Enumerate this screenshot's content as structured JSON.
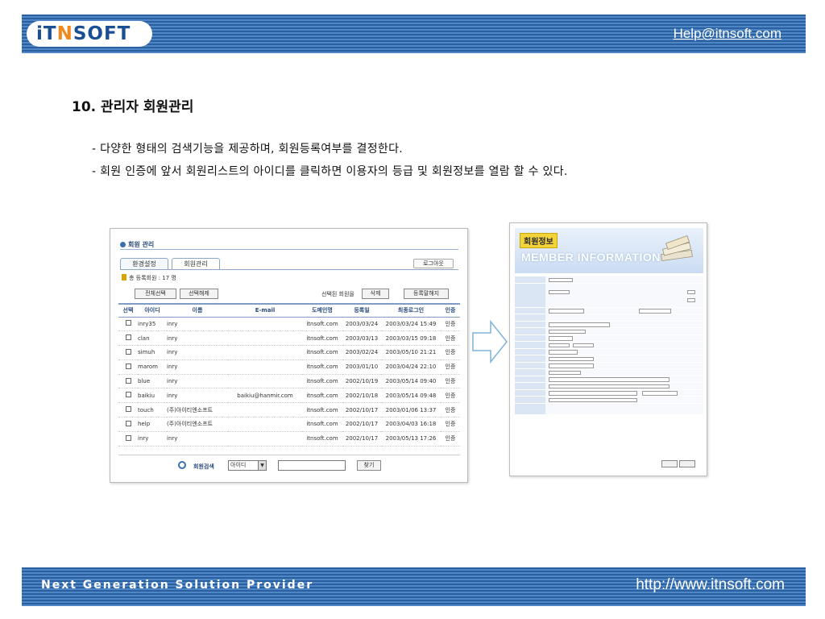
{
  "header": {
    "logo_it": "iT",
    "logo_n": "N",
    "logo_soft": "SOFT",
    "help": "Help@itnsoft.com"
  },
  "content": {
    "title": "10. 관리자 회원관리",
    "bullets": [
      "- 다양한 형태의 검색기능을 제공하며, 회원등록여부를 결정한다.",
      "- 회원 인증에 앞서 회원리스트의 아이디를 클릭하면 이용자의 등급  및 회원정보를 열람 할 수 있다."
    ]
  },
  "member_management": {
    "title": "회원 관리",
    "tabs": [
      "환경설정",
      "회원관리"
    ],
    "logout": "로그아웃",
    "total": "총 등록회원 : 17 명",
    "select_all": "전체선택",
    "deselect": "선택해제",
    "selected_label": "선택된 회원을",
    "delete": "삭제",
    "unregister": "등록말해지",
    "columns": [
      "선택",
      "아이디",
      "이름",
      "E-mail",
      "도메인명",
      "등록일",
      "최종로그인",
      "인증"
    ],
    "rows": [
      {
        "id": "inry35",
        "name": "inry",
        "email": "",
        "domain": "itnsoft.com",
        "registered": "2003/03/24",
        "last_login": "2003/03/24 15:49",
        "auth": "인증"
      },
      {
        "id": "clan",
        "name": "inry",
        "email": "",
        "domain": "itnsoft.com",
        "registered": "2003/03/13",
        "last_login": "2003/03/15 09:18",
        "auth": "인증"
      },
      {
        "id": "simuh",
        "name": "inry",
        "email": "",
        "domain": "itnsoft.com",
        "registered": "2003/02/24",
        "last_login": "2003/05/10 21:21",
        "auth": "인증"
      },
      {
        "id": "marom",
        "name": "inry",
        "email": "",
        "domain": "itnsoft.com",
        "registered": "2003/01/10",
        "last_login": "2003/04/24 22:10",
        "auth": "인증"
      },
      {
        "id": "blue",
        "name": "inry",
        "email": "",
        "domain": "itnsoft.com",
        "registered": "2002/10/19",
        "last_login": "2003/05/14 09:40",
        "auth": "인증"
      },
      {
        "id": "baikiu",
        "name": "inry",
        "email": "baikiu@hanmir.com",
        "domain": "itnsoft.com",
        "registered": "2002/10/18",
        "last_login": "2003/05/14 09:48",
        "auth": "인증"
      },
      {
        "id": "touch",
        "name": "(주)아이티엔소프트",
        "email": "",
        "domain": "itnsoft.com",
        "registered": "2002/10/17",
        "last_login": "2003/01/06 13:37",
        "auth": "인증"
      },
      {
        "id": "help",
        "name": "(주)아이티엔소프트",
        "email": "",
        "domain": "itnsoft.com",
        "registered": "2002/10/17",
        "last_login": "2003/04/03 16:18",
        "auth": "인증"
      },
      {
        "id": "inry",
        "name": "inry",
        "email": "",
        "domain": "itnsoft.com",
        "registered": "2002/10/17",
        "last_login": "2003/05/13 17:26",
        "auth": "인증"
      }
    ],
    "search_label": "회원검색",
    "search_option": "아이디",
    "search_button": "찾기"
  },
  "member_info": {
    "badge": "회원정보",
    "subtitle": "MEMBER INFORMATION"
  },
  "footer": {
    "tagline": "Next Generation Solution Provider",
    "url": "http://www.itnsoft.com"
  },
  "colors": {
    "header_band": "#2a5fa0",
    "header_stripe": "#4f86c6",
    "logo_blue": "#1b4f93",
    "logo_orange": "#f08a1c"
  }
}
